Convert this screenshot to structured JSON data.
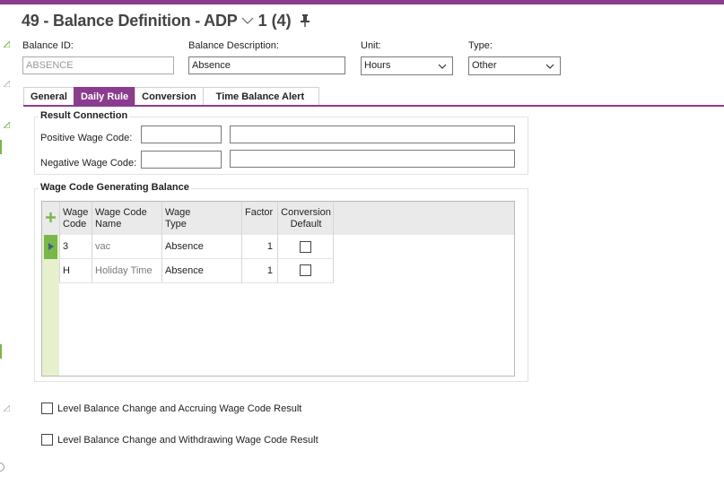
{
  "header": {
    "title": "49 - Balance Definition - ADP",
    "record_counter": "1 (4)"
  },
  "fields": {
    "balance_id_label": "Balance ID:",
    "balance_id_value": "ABSENCE",
    "balance_description_label": "Balance Description:",
    "balance_description_value": "Absence",
    "unit_label": "Unit:",
    "unit_value": "Hours",
    "type_label": "Type:",
    "type_value": "Other"
  },
  "tabs": [
    {
      "label": "General",
      "active": false
    },
    {
      "label": "Daily Rule",
      "active": true
    },
    {
      "label": "Conversion",
      "active": false
    },
    {
      "label": "Time Balance Alert",
      "active": false
    }
  ],
  "result_connection": {
    "title": "Result Connection",
    "positive_label": "Positive Wage Code:",
    "positive_code": "",
    "positive_desc": "",
    "negative_label": "Negative Wage Code:",
    "negative_code": "",
    "negative_desc": ""
  },
  "wage_grid": {
    "title": "Wage Code Generating Balance",
    "columns": {
      "wage_code_1": "Wage",
      "wage_code_2": "Code",
      "name_1": "Wage Code",
      "name_2": "Name",
      "type_1": "Wage",
      "type_2": "Type",
      "factor": "Factor",
      "conv_1": "Conversion",
      "conv_2": "Default"
    },
    "rows": [
      {
        "code": "3",
        "name": "vac",
        "type": "Absence",
        "factor": "1",
        "conversion_default": false,
        "current": true
      },
      {
        "code": "H",
        "name": "Holiday Time",
        "type": "Absence",
        "factor": "1",
        "conversion_default": false,
        "current": false
      }
    ]
  },
  "options": {
    "level_accruing_label": "Level Balance Change and Accruing Wage Code Result",
    "level_accruing_checked": false,
    "level_withdrawing_label": "Level Balance Change and Withdrawing Wage Code Result",
    "level_withdrawing_checked": false
  },
  "colors": {
    "accent": "#8a3c8e",
    "grid_side": "#e6f0cd",
    "row_marker": "#7ab648"
  },
  "icons": {
    "title_dropdown": "chevron-down-icon",
    "pin": "pin-icon",
    "add_row": "plus-icon",
    "current_row": "triangle-right-icon"
  }
}
